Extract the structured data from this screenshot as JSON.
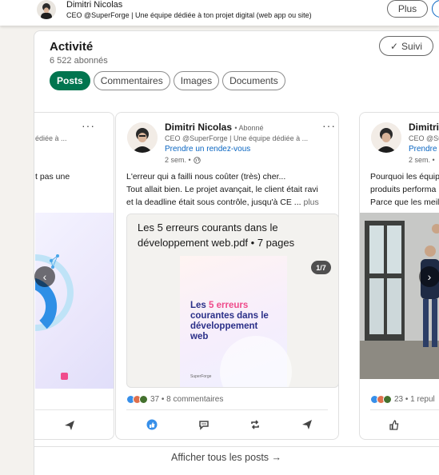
{
  "topbar": {
    "name": "Dimitri Nicolas",
    "headline": "CEO @SuperForge | Une équipe dédiée à ton projet digital (web app ou site)",
    "plus_label": "Plus"
  },
  "activity": {
    "title": "Activité",
    "followers": "6 522 abonnés",
    "follow_label": "Suivi",
    "filters": [
      "Posts",
      "Commentaires",
      "Images",
      "Documents"
    ],
    "active_filter": "Posts"
  },
  "left_post": {
    "headline_fragment": "édiée à ...",
    "text_fragment": "t pas une"
  },
  "main_post": {
    "author": "Dimitri Nicolas",
    "relation": "• Abonné",
    "headline": "CEO @SuperForge | Une équipe dédiée à ...",
    "cta": "Prendre un rendez-vous",
    "time": "2 sem. •",
    "text_lines": [
      "L'erreur qui a failli nous coûter (très) cher...",
      "Tout allait bien. Le projet avançait, le client était ravi",
      "et la deadline était sous contrôle, jusqu'à CE  ..."
    ],
    "more_label": "plus",
    "document": {
      "title": "Les 5 erreurs courants dans le développement web.pdf • 7 pages",
      "pager": "1/7",
      "cover_prefix": "Les ",
      "cover_highlight": "5 erreurs",
      "cover_rest": "courantes dans le développement web",
      "brand": "SuperForge"
    },
    "reactions_count": "37",
    "comments": "• 8 commentaires"
  },
  "right_post": {
    "author": "Dimitri",
    "headline_fragment": "CEO @Su",
    "cta_fragment": "Prendre u",
    "time": "2 sem. •",
    "text_lines": [
      "Pourquoi les équip",
      "produits performa",
      "Parce que les meil"
    ],
    "reactions_count": "23",
    "comments_fragment": "• 1 repul"
  },
  "footer": {
    "show_all": "Afficher tous les posts →"
  },
  "colors": {
    "brand_green": "#01754f",
    "link_blue": "#0a66c2"
  }
}
